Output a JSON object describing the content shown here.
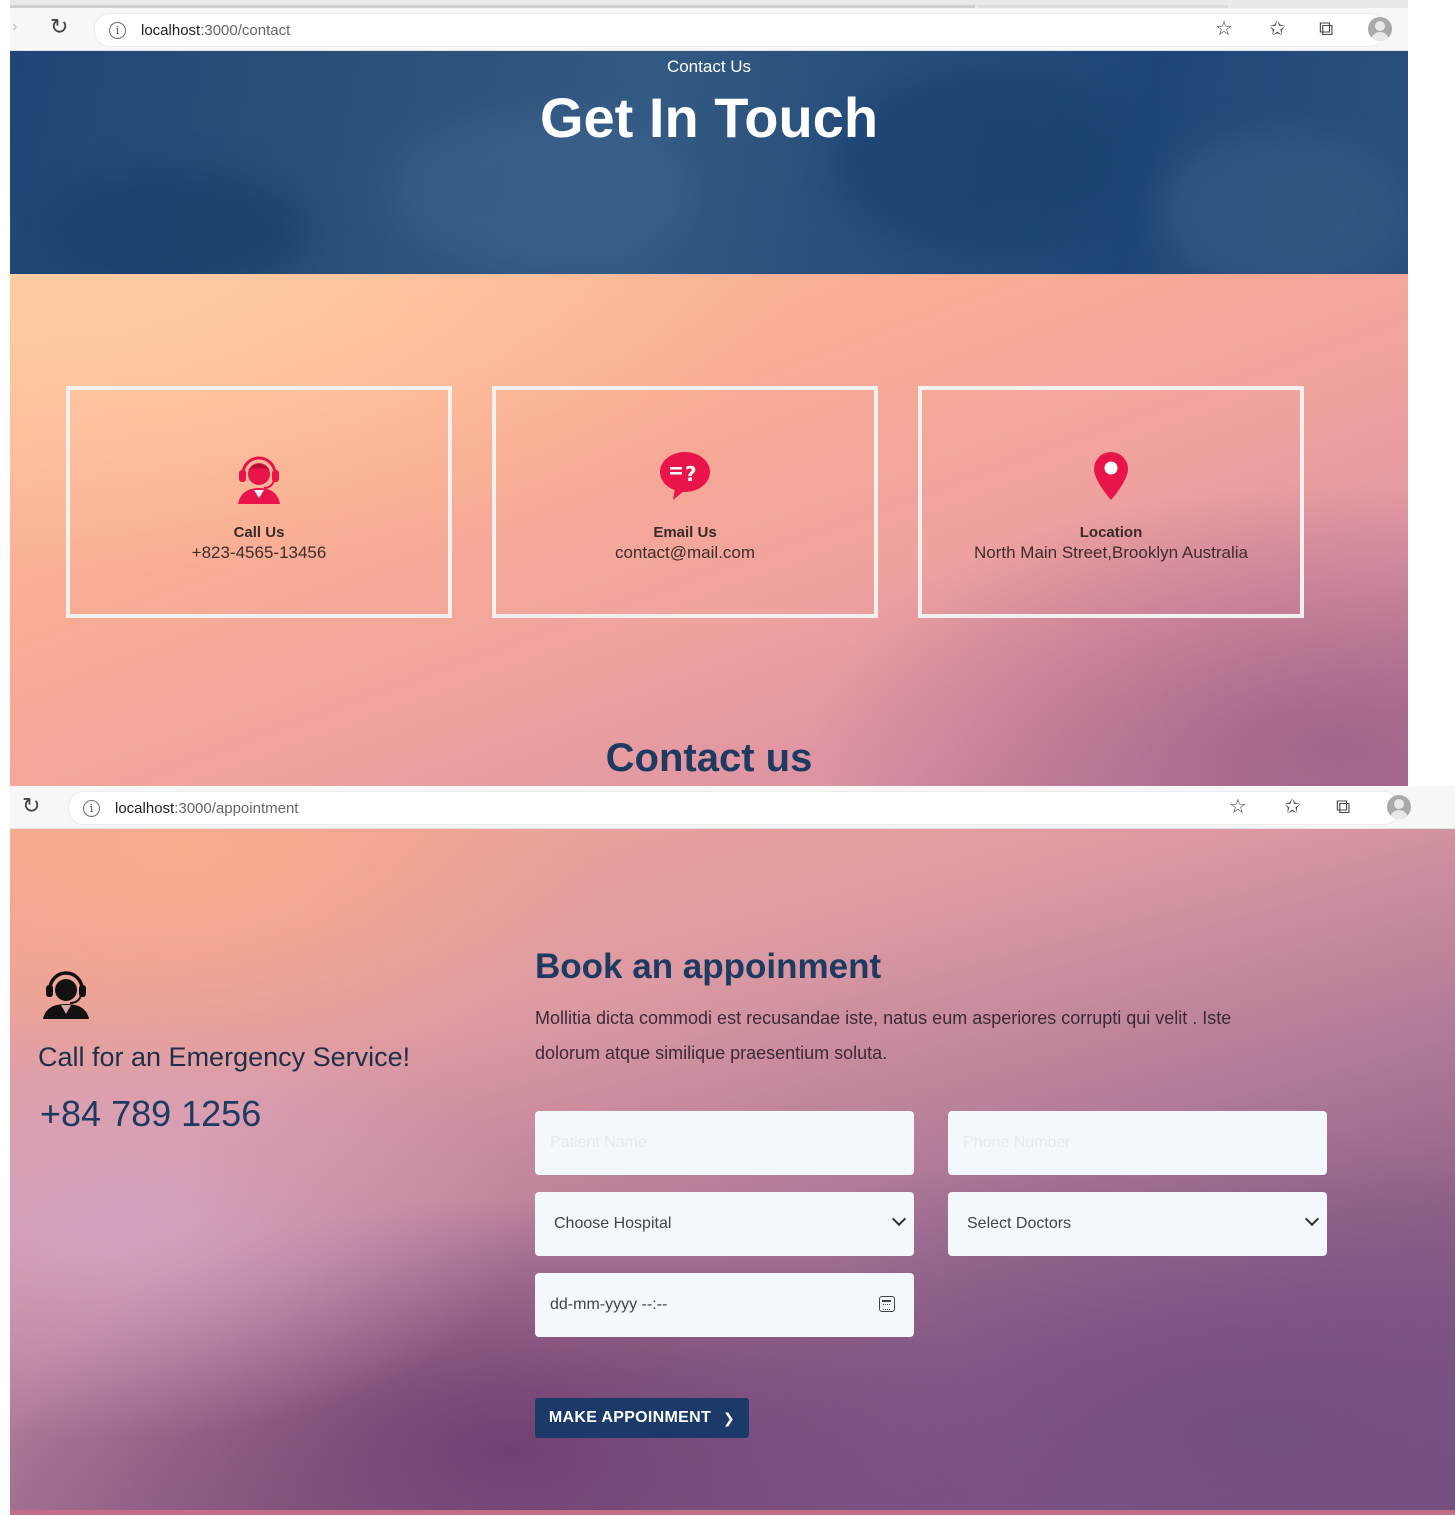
{
  "contact_window": {
    "browser": {
      "url_host": "localhost",
      "url_path": ":3000/contact"
    },
    "hero": {
      "subtitle": "Contact Us",
      "title": "Get In Touch"
    },
    "cards": [
      {
        "icon": "headset-agent-icon",
        "title": "Call Us",
        "value": "+823-4565-13456"
      },
      {
        "icon": "email-question-icon",
        "title": "Email Us",
        "value": "contact@mail.com"
      },
      {
        "icon": "location-pin-icon",
        "title": "Location",
        "value": "North Main Street,Brooklyn Australia"
      }
    ],
    "section_heading": "Contact us",
    "colors": {
      "hero_blue": "#284f7c",
      "accent_red": "#e8144a",
      "heading_navy": "#1d3a62"
    }
  },
  "appointment_window": {
    "browser": {
      "url_host": "localhost",
      "url_path": ":3000/appointment"
    },
    "emergency": {
      "title": "Call for an Emergency Service!",
      "phone": "+84 789 1256"
    },
    "booking": {
      "title": "Book an appoinment",
      "description": "Mollitia dicta commodi est recusandae iste, natus eum asperiores corrupti qui velit . Iste dolorum atque similique praesentium soluta.",
      "patient_name_placeholder": "Patient Name",
      "phone_placeholder": "Phone Number",
      "hospital_select": "Choose Hospital",
      "doctor_select": "Select Doctors",
      "datetime_placeholder": "dd-mm-yyyy --:--",
      "submit_label": "MAKE APPOINMENT"
    },
    "colors": {
      "button_navy": "#1c3a69",
      "field_bg": "#f3f8fc"
    }
  }
}
